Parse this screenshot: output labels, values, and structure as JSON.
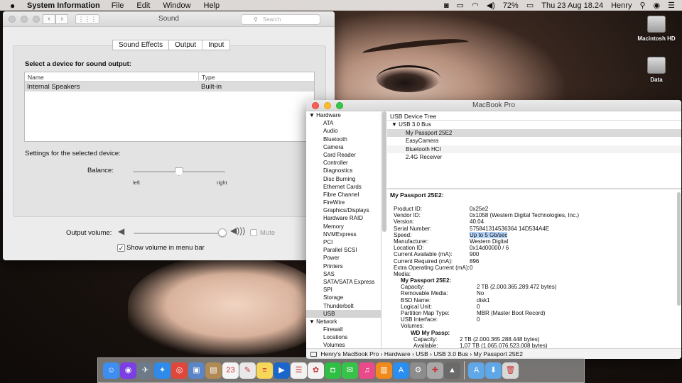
{
  "menubar": {
    "app_name": "System Information",
    "menus": [
      "File",
      "Edit",
      "Window",
      "Help"
    ],
    "battery": "72%",
    "clock": "Thu 23 Aug  18.24",
    "user": "Henry"
  },
  "desktop": {
    "icons": [
      {
        "label": "Macintosh HD"
      },
      {
        "label": "Data"
      }
    ]
  },
  "sound_window": {
    "title": "Sound",
    "search_placeholder": "Search",
    "tabs": [
      "Sound Effects",
      "Output",
      "Input"
    ],
    "selected_tab": "Output",
    "select_label": "Select a device for sound output:",
    "columns": [
      "Name",
      "Type"
    ],
    "devices": [
      {
        "name": "Internal Speakers",
        "type": "Built-in"
      }
    ],
    "settings_label": "Settings for the selected device:",
    "balance_label": "Balance:",
    "balance_left": "left",
    "balance_right": "right",
    "balance_value": 0.5,
    "output_volume_label": "Output volume:",
    "output_volume_value": 0.96,
    "mute_label": "Mute",
    "mute_checked": false,
    "show_volume_label": "Show volume in menu bar",
    "show_volume_checked": true
  },
  "sysinfo_window": {
    "title": "MacBook Pro",
    "sidebar": [
      {
        "label": "Hardware",
        "head": true
      },
      {
        "label": "ATA"
      },
      {
        "label": "Audio"
      },
      {
        "label": "Bluetooth"
      },
      {
        "label": "Camera"
      },
      {
        "label": "Card Reader"
      },
      {
        "label": "Controller"
      },
      {
        "label": "Diagnostics"
      },
      {
        "label": "Disc Burning"
      },
      {
        "label": "Ethernet Cards"
      },
      {
        "label": "Fibre Channel"
      },
      {
        "label": "FireWire"
      },
      {
        "label": "Graphics/Displays"
      },
      {
        "label": "Hardware RAID"
      },
      {
        "label": "Memory"
      },
      {
        "label": "NVMExpress"
      },
      {
        "label": "PCI"
      },
      {
        "label": "Parallel SCSI"
      },
      {
        "label": "Power"
      },
      {
        "label": "Printers"
      },
      {
        "label": "SAS"
      },
      {
        "label": "SATA/SATA Express"
      },
      {
        "label": "SPI"
      },
      {
        "label": "Storage"
      },
      {
        "label": "Thunderbolt"
      },
      {
        "label": "USB",
        "selected": true
      },
      {
        "label": "Network",
        "head": true
      },
      {
        "label": "Firewall"
      },
      {
        "label": "Locations"
      },
      {
        "label": "Volumes"
      }
    ],
    "tree_header": "USB Device Tree",
    "tree": [
      {
        "label": "▼ USB 3.0 Bus",
        "level": 0
      },
      {
        "label": "My Passport 25E2",
        "level": 1,
        "selected": true
      },
      {
        "label": "EasyCamera",
        "level": 1
      },
      {
        "label": "Bluetooth HCI",
        "level": 1
      },
      {
        "label": "2.4G Receiver",
        "level": 1
      }
    ],
    "detail_title": "My Passport 25E2:",
    "details": [
      {
        "k": "Product ID:",
        "v": "0x25e2"
      },
      {
        "k": "Vendor ID:",
        "v": "0x1058  (Western Digital Technologies, Inc.)"
      },
      {
        "k": "Version:",
        "v": "40.04"
      },
      {
        "k": "Serial Number:",
        "v": "575841314536364 14D534A4E"
      },
      {
        "k": "Speed:",
        "v": "Up to 5 Gb/sec",
        "highlight": true
      },
      {
        "k": "Manufacturer:",
        "v": "Western Digital"
      },
      {
        "k": "Location ID:",
        "v": "0x14d00000 / 6"
      },
      {
        "k": "Current Available (mA):",
        "v": "900"
      },
      {
        "k": "Current Required (mA):",
        "v": "896"
      },
      {
        "k": "Extra Operating Current (mA):",
        "v": "0"
      },
      {
        "k": "Media:",
        "v": ""
      },
      {
        "k": "My Passport 25E2:",
        "v": "",
        "indent": "i1",
        "bold": true
      },
      {
        "k": "Capacity:",
        "v": "2 TB (2.000.365.289.472 bytes)",
        "indent": "i1"
      },
      {
        "k": "Removable Media:",
        "v": "No",
        "indent": "i1"
      },
      {
        "k": "BSD Name:",
        "v": "disk1",
        "indent": "i1"
      },
      {
        "k": "Logical Unit:",
        "v": "0",
        "indent": "i1"
      },
      {
        "k": "Partition Map Type:",
        "v": "MBR (Master Boot Record)",
        "indent": "i1"
      },
      {
        "k": "USB Interface:",
        "v": "0",
        "indent": "i1"
      },
      {
        "k": "Volumes:",
        "v": "",
        "indent": "i1"
      },
      {
        "k": "WD My Passp:",
        "v": "",
        "indent": "i3",
        "bold": true
      },
      {
        "k": "Capacity:",
        "v": "2 TB (2.000.365.288.448 bytes)",
        "indent": "i4"
      },
      {
        "k": "Available:",
        "v": "1,07 TB (1.065.076.523.008 bytes)",
        "indent": "i4"
      }
    ],
    "path": [
      "Henry's MacBook Pro",
      "Hardware",
      "USB",
      "USB 3.0 Bus",
      "My Passport 25E2"
    ]
  },
  "dock": {
    "icons": [
      {
        "name": "finder-icon",
        "glyph": "☺",
        "color": "#3d8ef0"
      },
      {
        "name": "siri-icon",
        "glyph": "◉",
        "color": "#7b3fe4"
      },
      {
        "name": "launchpad-icon",
        "glyph": "✈",
        "color": "#6c7a8a"
      },
      {
        "name": "safari-icon",
        "glyph": "✦",
        "color": "#2e8bea"
      },
      {
        "name": "chrome-icon",
        "glyph": "◎",
        "color": "#e0473b"
      },
      {
        "name": "photo-preview-icon",
        "glyph": "▣",
        "color": "#5a85c6"
      },
      {
        "name": "contacts-icon",
        "glyph": "▤",
        "color": "#b08a55"
      },
      {
        "name": "calendar-icon",
        "glyph": "23",
        "color": "#f4f4f4"
      },
      {
        "name": "textedit-icon",
        "glyph": "✎",
        "color": "#e8e8e8"
      },
      {
        "name": "notes-icon",
        "glyph": "≡",
        "color": "#f6d75a"
      },
      {
        "name": "keynote-icon",
        "glyph": "▶",
        "color": "#1b66c9"
      },
      {
        "name": "reminders-icon",
        "glyph": "☰",
        "color": "#f2f2f2"
      },
      {
        "name": "photos-icon",
        "glyph": "✿",
        "color": "#f2f2f2"
      },
      {
        "name": "facetime-icon",
        "glyph": "◘",
        "color": "#2fbf45"
      },
      {
        "name": "messages-icon",
        "glyph": "✉",
        "color": "#37c24a"
      },
      {
        "name": "itunes-icon",
        "glyph": "♫",
        "color": "#e94a8a"
      },
      {
        "name": "ibooks-icon",
        "glyph": "▥",
        "color": "#f08a1c"
      },
      {
        "name": "app-store-icon",
        "glyph": "A",
        "color": "#2a8ef0"
      },
      {
        "name": "system-preferences-icon",
        "glyph": "⚙",
        "color": "#8c8c8c"
      },
      {
        "name": "disk-utility-icon",
        "glyph": "✚",
        "color": "#a8a8a8"
      },
      {
        "name": "system-information-icon",
        "glyph": "▲",
        "color": "#6a6a6a"
      },
      {
        "name": "applications-folder-icon",
        "glyph": "A",
        "color": "#5fa7e6",
        "sep_before": true
      },
      {
        "name": "downloads-folder-icon",
        "glyph": "⬇",
        "color": "#5fa7e6"
      },
      {
        "name": "trash-icon",
        "glyph": "🗑",
        "color": "#d8d8d8"
      }
    ]
  }
}
